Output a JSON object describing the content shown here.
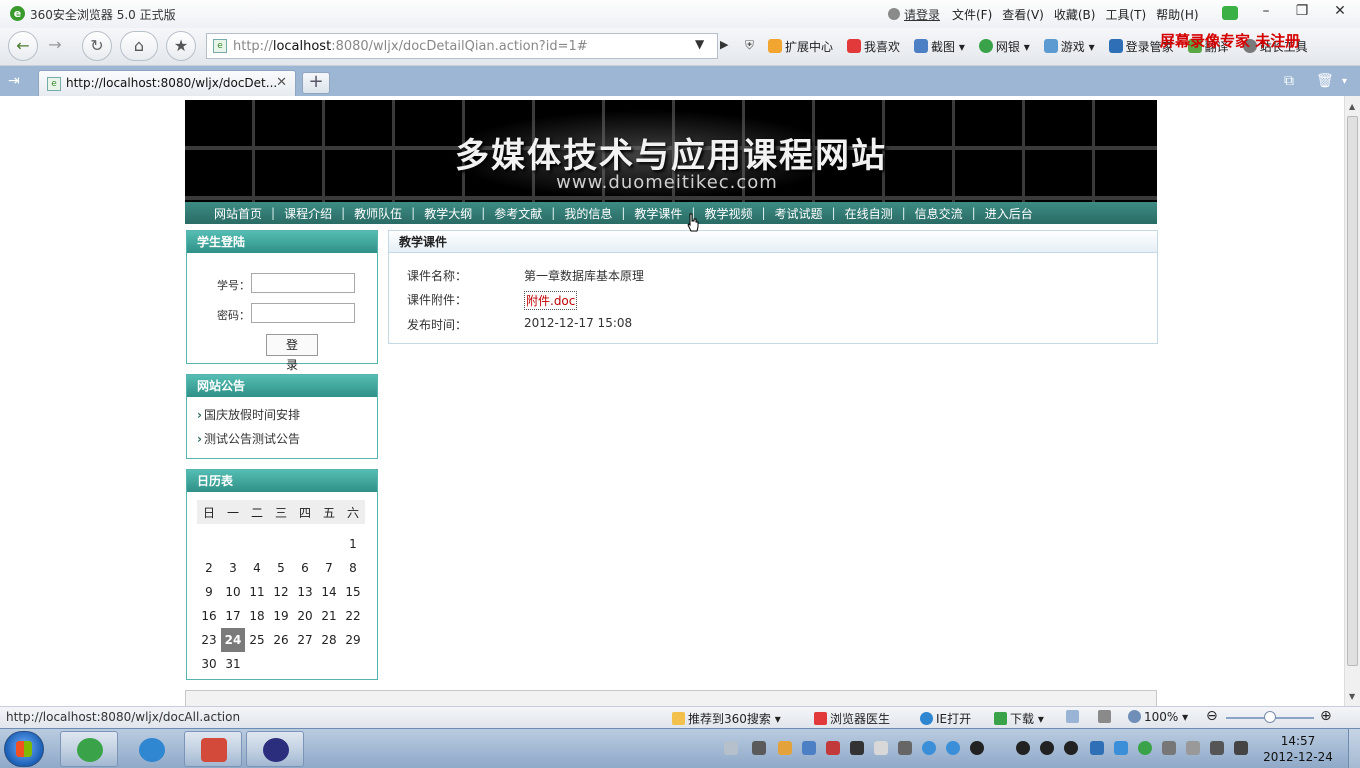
{
  "browser": {
    "title": "360安全浏览器 5.0 正式版",
    "login_link": "请登录",
    "menu": [
      "文件(F)",
      "查看(V)",
      "收藏(B)",
      "工具(T)",
      "帮助(H)"
    ],
    "watermark": "屏幕录像专家 未注册",
    "url_prefix": "http://",
    "url_host": "localhost",
    "url_rest": ":8080/wljx/docDetailQian.action?id=1#",
    "toolbar": [
      "扩展中心",
      "我喜欢",
      "截图",
      "网银",
      "游戏",
      "登录管家",
      "翻译",
      "站长工具"
    ],
    "tab_title": "http://localhost:8080/wljx/docDet...",
    "status_url": "http://localhost:8080/wljx/docAll.action",
    "status_items": {
      "recommend": "推荐到360搜索",
      "doctor": "浏览器医生",
      "ie_open": "IE打开",
      "download": "下载",
      "zoom": "100%"
    }
  },
  "site": {
    "title": "多媒体技术与应用课程网站",
    "url": "www.duomeitikec.com",
    "nav": [
      "网站首页",
      "课程介绍",
      "教师队伍",
      "教学大纲",
      "参考文献",
      "我的信息",
      "教学课件",
      "教学视频",
      "考试试题",
      "在线自测",
      "信息交流",
      "进入后台"
    ]
  },
  "sidebar": {
    "login": {
      "title": "学生登陆",
      "student_id_label": "学号：",
      "password_label": "密码：",
      "submit": "登 录"
    },
    "notices": {
      "title": "网站公告",
      "items": [
        "国庆放假时间安排",
        "测试公告测试公告"
      ]
    },
    "calendar": {
      "title": "日历表",
      "weekdays": [
        "日",
        "一",
        "二",
        "三",
        "四",
        "五",
        "六"
      ],
      "weeks": [
        [
          "",
          "",
          "",
          "",
          "",
          "",
          "1"
        ],
        [
          "2",
          "3",
          "4",
          "5",
          "6",
          "7",
          "8"
        ],
        [
          "9",
          "10",
          "11",
          "12",
          "13",
          "14",
          "15"
        ],
        [
          "16",
          "17",
          "18",
          "19",
          "20",
          "21",
          "22"
        ],
        [
          "23",
          "24",
          "25",
          "26",
          "27",
          "28",
          "29"
        ],
        [
          "30",
          "31",
          "",
          "",
          "",
          "",
          ""
        ]
      ],
      "today": "24"
    }
  },
  "main": {
    "title": "教学课件",
    "rows": [
      {
        "label": "课件名称：",
        "value": "第一章数据库基本原理"
      },
      {
        "label": "课件附件：",
        "value": "附件.doc"
      },
      {
        "label": "发布时间：",
        "value": "2012-12-17 15:08"
      }
    ]
  },
  "taskbar": {
    "time": "14:57",
    "date": "2012-12-24"
  }
}
